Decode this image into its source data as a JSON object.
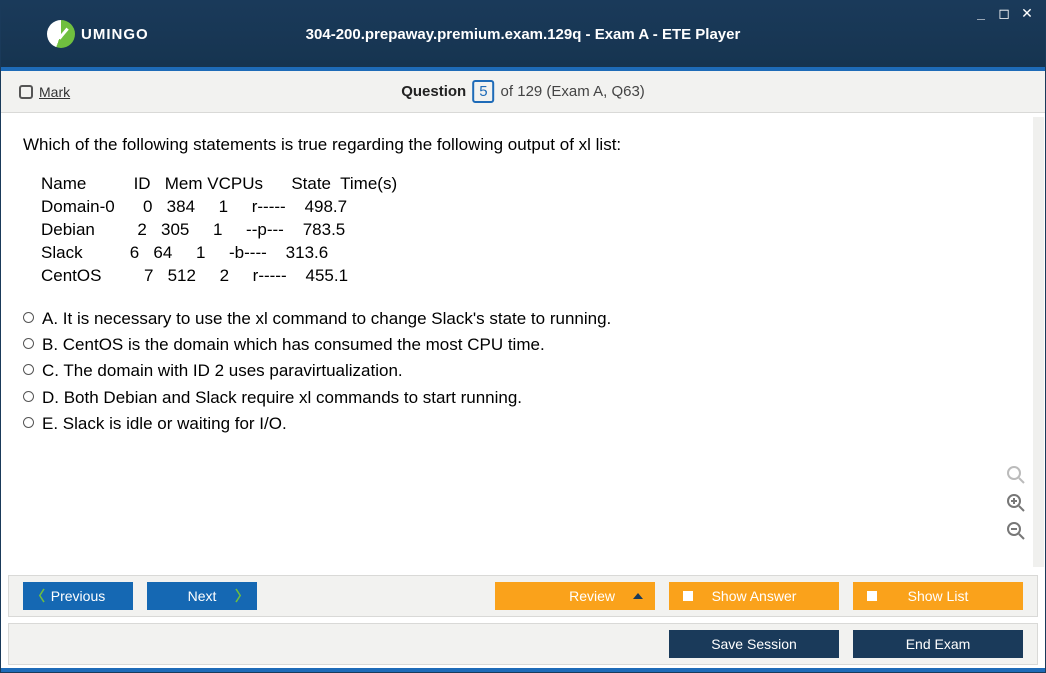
{
  "header": {
    "brand": "UMINGO",
    "title": "304-200.prepaway.premium.exam.129q - Exam A - ETE Player"
  },
  "questionBar": {
    "markLabel": "Mark",
    "label": "Question",
    "number": "5",
    "of": "of 129 (Exam A, Q63)"
  },
  "question": {
    "stem": "Which of the following statements is true regarding the following output of xl list:",
    "consoleLines": [
      "Name          ID   Mem VCPUs      State  Time(s)",
      "Domain-0      0   384     1     r-----    498.7",
      "Debian         2   305     1     --p---    783.5",
      "Slack          6   64     1     -b----    313.6",
      "CentOS         7   512     2     r-----    455.1"
    ],
    "options": [
      {
        "letter": "A.",
        "text": "It is necessary to use the xl command to change Slack's state to running."
      },
      {
        "letter": "B.",
        "text": "CentOS is the domain which has consumed the most CPU time."
      },
      {
        "letter": "C.",
        "text": "The domain with ID 2 uses paravirtualization."
      },
      {
        "letter": "D.",
        "text": "Both Debian and Slack require xl commands to start running."
      },
      {
        "letter": "E.",
        "text": "Slack is idle or waiting for I/O."
      }
    ]
  },
  "buttons": {
    "previous": "Previous",
    "next": "Next",
    "review": "Review",
    "showAnswer": "Show Answer",
    "showList": "Show List",
    "saveSession": "Save Session",
    "endExam": "End Exam"
  }
}
